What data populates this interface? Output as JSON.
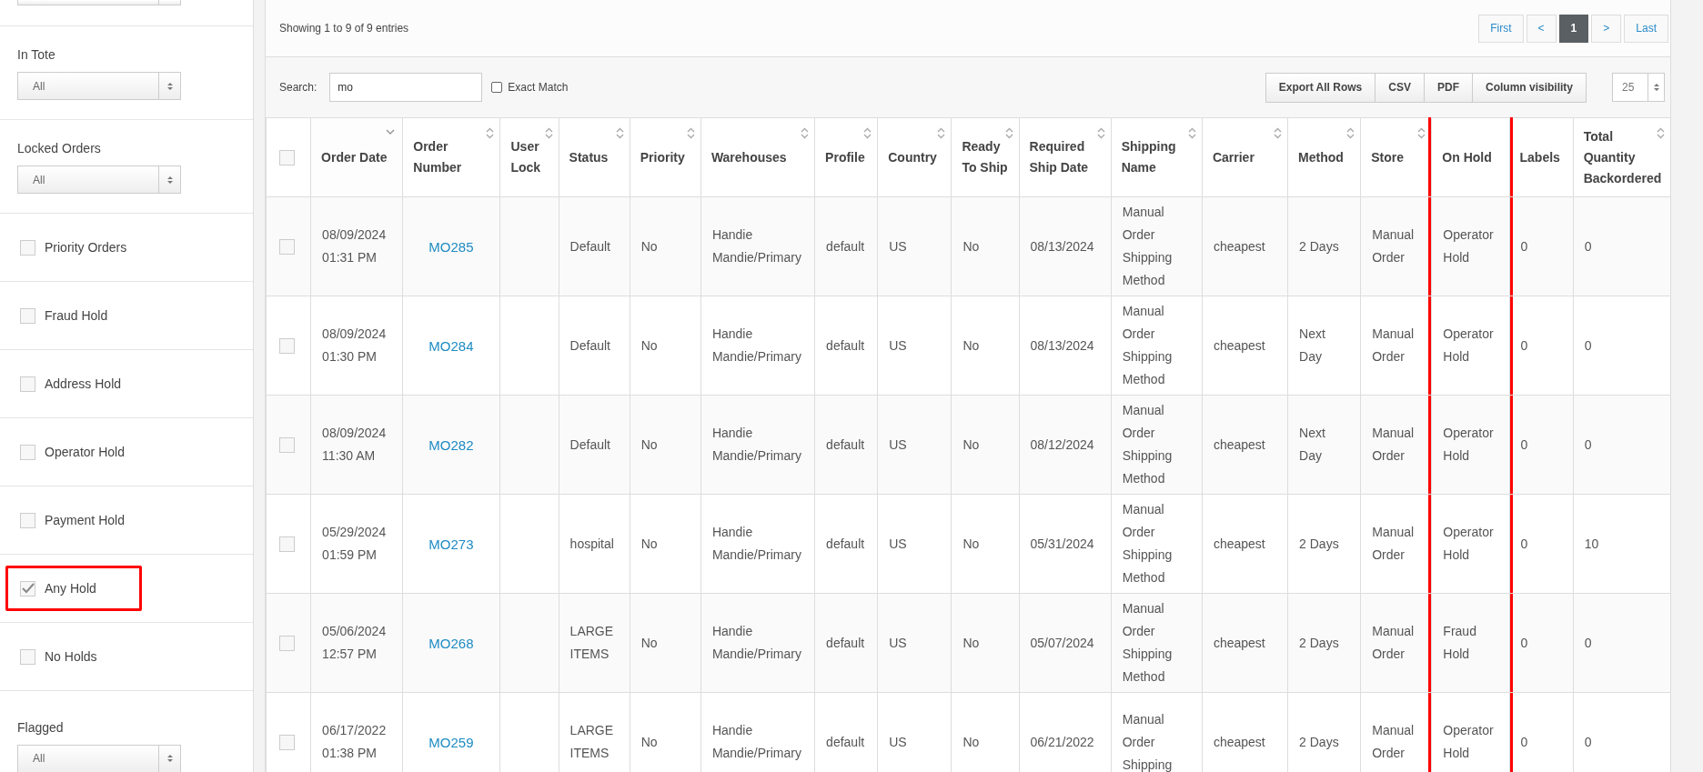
{
  "sidebar": {
    "filters": [
      {
        "kind": "select"
      },
      {
        "kind": "select",
        "label": "In Tote",
        "value": "All"
      },
      {
        "kind": "select",
        "label": "Locked Orders",
        "value": "All"
      },
      {
        "kind": "checkbox",
        "label": "Priority Orders",
        "checked": false,
        "highlighted": false
      },
      {
        "kind": "checkbox",
        "label": "Fraud Hold",
        "checked": false,
        "highlighted": false
      },
      {
        "kind": "checkbox",
        "label": "Address Hold",
        "checked": false,
        "highlighted": false
      },
      {
        "kind": "checkbox",
        "label": "Operator Hold",
        "checked": false,
        "highlighted": false
      },
      {
        "kind": "checkbox",
        "label": "Payment Hold",
        "checked": false,
        "highlighted": false
      },
      {
        "kind": "checkbox",
        "label": "Any Hold",
        "checked": true,
        "highlighted": true
      },
      {
        "kind": "checkbox",
        "label": "No Holds",
        "checked": false,
        "highlighted": false
      },
      {
        "kind": "select",
        "label": "Flagged",
        "value": "All"
      }
    ]
  },
  "info": "Showing 1 to 9 of 9 entries",
  "pagination": [
    {
      "label": "First",
      "selected": false
    },
    {
      "label": "<",
      "selected": false
    },
    {
      "label": "1",
      "selected": true
    },
    {
      "label": ">",
      "selected": false
    },
    {
      "label": "Last",
      "selected": false
    }
  ],
  "search": {
    "label": "Search:",
    "value": "mo",
    "exact_match": {
      "label": "Exact Match",
      "checked": false
    }
  },
  "export_buttons": [
    "Export All Rows",
    "CSV",
    "PDF",
    "Column visibility"
  ],
  "page_size": "25",
  "table": {
    "select_all_checked": false,
    "columns": [
      {
        "label": "Order Date",
        "sortable": true,
        "sorted_descending": true,
        "highlighted": false
      },
      {
        "label": "Order Number",
        "sortable": true,
        "sorted_descending": false,
        "highlighted": false
      },
      {
        "label": "User Lock",
        "sortable": true,
        "sorted_descending": false,
        "highlighted": false
      },
      {
        "label": "Status",
        "sortable": true,
        "sorted_descending": false,
        "highlighted": false
      },
      {
        "label": "Priority",
        "sortable": true,
        "sorted_descending": false,
        "highlighted": false
      },
      {
        "label": "Warehouses",
        "sortable": true,
        "sorted_descending": false,
        "highlighted": false
      },
      {
        "label": "Profile",
        "sortable": true,
        "sorted_descending": false,
        "highlighted": false
      },
      {
        "label": "Country",
        "sortable": true,
        "sorted_descending": false,
        "highlighted": false
      },
      {
        "label": "Ready To Ship",
        "sortable": true,
        "sorted_descending": false,
        "highlighted": false
      },
      {
        "label": "Required Ship Date",
        "sortable": true,
        "sorted_descending": false,
        "highlighted": false
      },
      {
        "label": "Shipping Name",
        "sortable": true,
        "sorted_descending": false,
        "highlighted": false
      },
      {
        "label": "Carrier",
        "sortable": true,
        "sorted_descending": false,
        "highlighted": false
      },
      {
        "label": "Method",
        "sortable": true,
        "sorted_descending": false,
        "highlighted": false
      },
      {
        "label": "Store",
        "sortable": true,
        "sorted_descending": false,
        "highlighted": false
      },
      {
        "label": "On Hold",
        "sortable": false,
        "sorted_descending": false,
        "highlighted": true
      },
      {
        "label": "Labels",
        "sortable": false,
        "sorted_descending": false,
        "highlighted": false
      },
      {
        "label": "Total Quantity Backordered",
        "sortable": true,
        "sorted_descending": false,
        "highlighted": false
      }
    ],
    "rows": [
      {
        "checked": false,
        "cells": [
          "08/09/2024 01:31 PM",
          "MO285",
          "",
          "Default",
          "No",
          "Handie Mandie/Primary",
          "default",
          "US",
          "No",
          "08/13/2024",
          "Manual Order Shipping Method",
          "cheapest",
          "2 Days",
          "Manual Order",
          "Operator Hold",
          "0",
          "0"
        ]
      },
      {
        "checked": false,
        "cells": [
          "08/09/2024 01:30 PM",
          "MO284",
          "",
          "Default",
          "No",
          "Handie Mandie/Primary",
          "default",
          "US",
          "No",
          "08/13/2024",
          "Manual Order Shipping Method",
          "cheapest",
          "Next Day",
          "Manual Order",
          "Operator Hold",
          "0",
          "0"
        ]
      },
      {
        "checked": false,
        "cells": [
          "08/09/2024 11:30 AM",
          "MO282",
          "",
          "Default",
          "No",
          "Handie Mandie/Primary",
          "default",
          "US",
          "No",
          "08/12/2024",
          "Manual Order Shipping Method",
          "cheapest",
          "Next Day",
          "Manual Order",
          "Operator Hold",
          "0",
          "0"
        ]
      },
      {
        "checked": false,
        "cells": [
          "05/29/2024 01:59 PM",
          "MO273",
          "",
          "hospital",
          "No",
          "Handie Mandie/Primary",
          "default",
          "US",
          "No",
          "05/31/2024",
          "Manual Order Shipping Method",
          "cheapest",
          "2 Days",
          "Manual Order",
          "Operator Hold",
          "0",
          "10"
        ]
      },
      {
        "checked": false,
        "cells": [
          "05/06/2024 12:57 PM",
          "MO268",
          "",
          "LARGE ITEMS",
          "No",
          "Handie Mandie/Primary",
          "default",
          "US",
          "No",
          "05/07/2024",
          "Manual Order Shipping Method",
          "cheapest",
          "2 Days",
          "Manual Order",
          "Fraud Hold",
          "0",
          "0"
        ]
      },
      {
        "checked": false,
        "cells": [
          "06/17/2022 01:38 PM",
          "MO259",
          "",
          "LARGE ITEMS",
          "No",
          "Handie Mandie/Primary",
          "default",
          "US",
          "No",
          "06/21/2022",
          "Manual Order Shipping",
          "cheapest",
          "2 Days",
          "Manual Order",
          "Operator Hold",
          "0",
          "0"
        ]
      }
    ]
  }
}
